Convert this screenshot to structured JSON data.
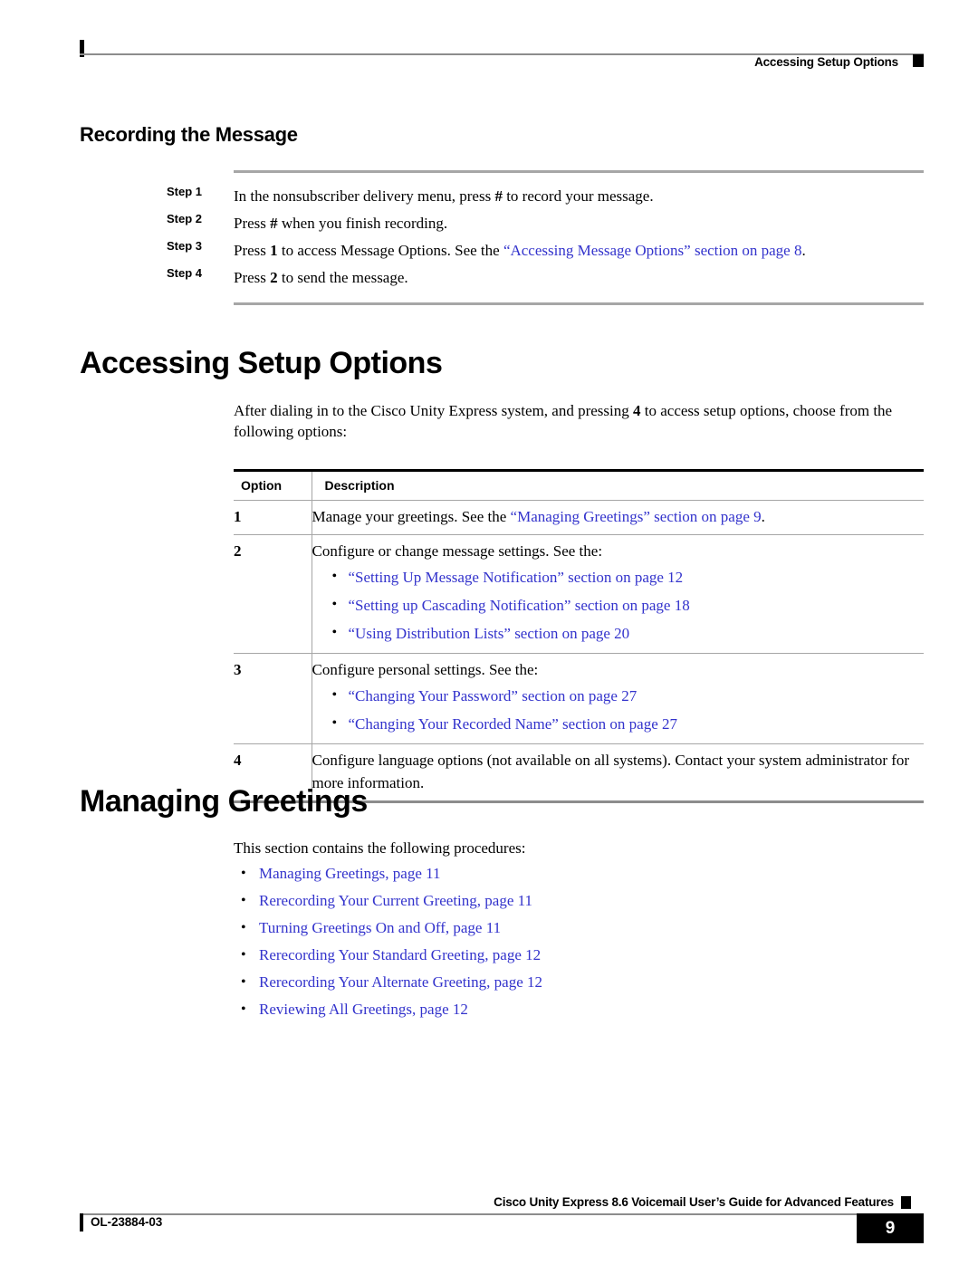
{
  "header": {
    "title": "Accessing Setup Options"
  },
  "sections": {
    "recording": {
      "heading": "Recording the Message",
      "steps": [
        {
          "label": "Step 1",
          "text_before": "In the nonsubscriber delivery menu, press ",
          "bold_key": "#",
          "text_after": " to record your message.",
          "link": "",
          "link_tail": ""
        },
        {
          "label": "Step 2",
          "text_before": "Press ",
          "bold_key": "#",
          "text_after": " when you finish recording.",
          "link": "",
          "link_tail": ""
        },
        {
          "label": "Step 3",
          "text_before": "Press ",
          "bold_key": "1",
          "text_after": " to access Message Options. See the ",
          "link": "“Accessing Message Options” section on page 8",
          "link_tail": "."
        },
        {
          "label": "Step 4",
          "text_before": "Press ",
          "bold_key": "2",
          "text_after": " to send the message.",
          "link": "",
          "link_tail": ""
        }
      ]
    },
    "accessing_setup_options": {
      "heading": "Accessing Setup Options",
      "intro_before": "After dialing in to the Cisco Unity Express system, and pressing ",
      "intro_key": "4",
      "intro_after": " to access setup options, choose from the following options:",
      "table": {
        "columns": [
          "Option",
          "Description"
        ],
        "rows": [
          {
            "option": "1",
            "desc_before": "Manage your greetings. See the ",
            "desc_link": "“Managing Greetings” section on page 9",
            "desc_after": ".",
            "bullets": []
          },
          {
            "option": "2",
            "desc_before": "Configure or change message settings. See the:",
            "desc_link": "",
            "desc_after": "",
            "bullets": [
              "“Setting Up Message Notification” section on page 12",
              "“Setting up Cascading Notification” section on page 18",
              "“Using Distribution Lists” section on page 20"
            ]
          },
          {
            "option": "3",
            "desc_before": "Configure personal settings. See the:",
            "desc_link": "",
            "desc_after": "",
            "bullets": [
              "“Changing Your Password” section on page 27",
              "“Changing Your Recorded Name” section on page 27"
            ]
          },
          {
            "option": "4",
            "desc_before": "Configure language options (not available on all systems). Contact your system administrator for more information.",
            "desc_link": "",
            "desc_after": "",
            "bullets": []
          }
        ]
      }
    },
    "managing_greetings": {
      "heading": "Managing Greetings",
      "intro": "This section contains the following procedures:",
      "procedures": [
        "Managing Greetings, page 11",
        "Rerecording Your Current Greeting, page 11",
        "Turning Greetings On and Off, page 11",
        "Rerecording Your Standard Greeting, page 12",
        "Rerecording Your Alternate Greeting, page 12",
        "Reviewing All Greetings, page 12"
      ]
    }
  },
  "footer": {
    "guide_title": "Cisco Unity Express 8.6 Voicemail User’s Guide for Advanced Features",
    "doc_id": "OL-23884-03",
    "page_number": "9"
  },
  "colors": {
    "link": "#3333CC",
    "rule_gray": "#8C8C8C",
    "text": "#000000"
  }
}
